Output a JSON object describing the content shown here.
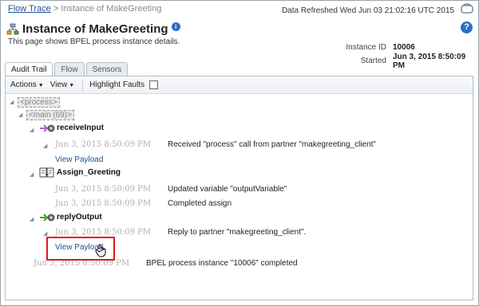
{
  "breadcrumb": {
    "flow_trace": "Flow Trace",
    "separator": ">",
    "current": "Instance of MakeGreeting"
  },
  "header": {
    "refresh_text": "Data Refreshed Wed Jun 03 21:02:16 UTC 2015",
    "title": "Instance of MakeGreeting",
    "description": "This page shows BPEL process instance details."
  },
  "meta": {
    "instance_id_label": "Instance ID",
    "instance_id_value": "10006",
    "started_label": "Started",
    "started_value": "Jun 3, 2015 8:50:09 PM"
  },
  "tabs": [
    {
      "label": "Audit Trail",
      "active": true
    },
    {
      "label": "Flow",
      "active": false
    },
    {
      "label": "Sensors",
      "active": false
    }
  ],
  "toolbar": {
    "actions": "Actions",
    "view": "View",
    "highlight_faults": "Highlight Faults",
    "highlight_checked": false
  },
  "tree": {
    "process_label": "<process>",
    "main_label": "<main (69)>",
    "receive": {
      "name": "receiveInput",
      "date": "Jun 3, 2015 8:50:09 PM",
      "message": "Received \"process\" call from partner \"makegreeting_client\"",
      "payload": "View Payload"
    },
    "assign": {
      "name": "Assign_Greeting",
      "date1": "Jun 3, 2015 8:50:09 PM",
      "message1": "Updated variable \"outputVariable\"",
      "date2": "Jun 3, 2015 8:50:09 PM",
      "message2": "Completed assign"
    },
    "reply": {
      "name": "replyOutput",
      "date": "Jun 3, 2015 8:50:09 PM",
      "message": "Reply to partner \"makegreeting_client\".",
      "payload": "View Payload"
    },
    "final": {
      "date": "Jun 3, 2015 8:50:09 PM",
      "message": "BPEL process instance \"10006\" completed"
    }
  },
  "colors": {
    "link": "#1e4f91",
    "highlight": "#e0161b",
    "info": "#2a6fc2"
  }
}
